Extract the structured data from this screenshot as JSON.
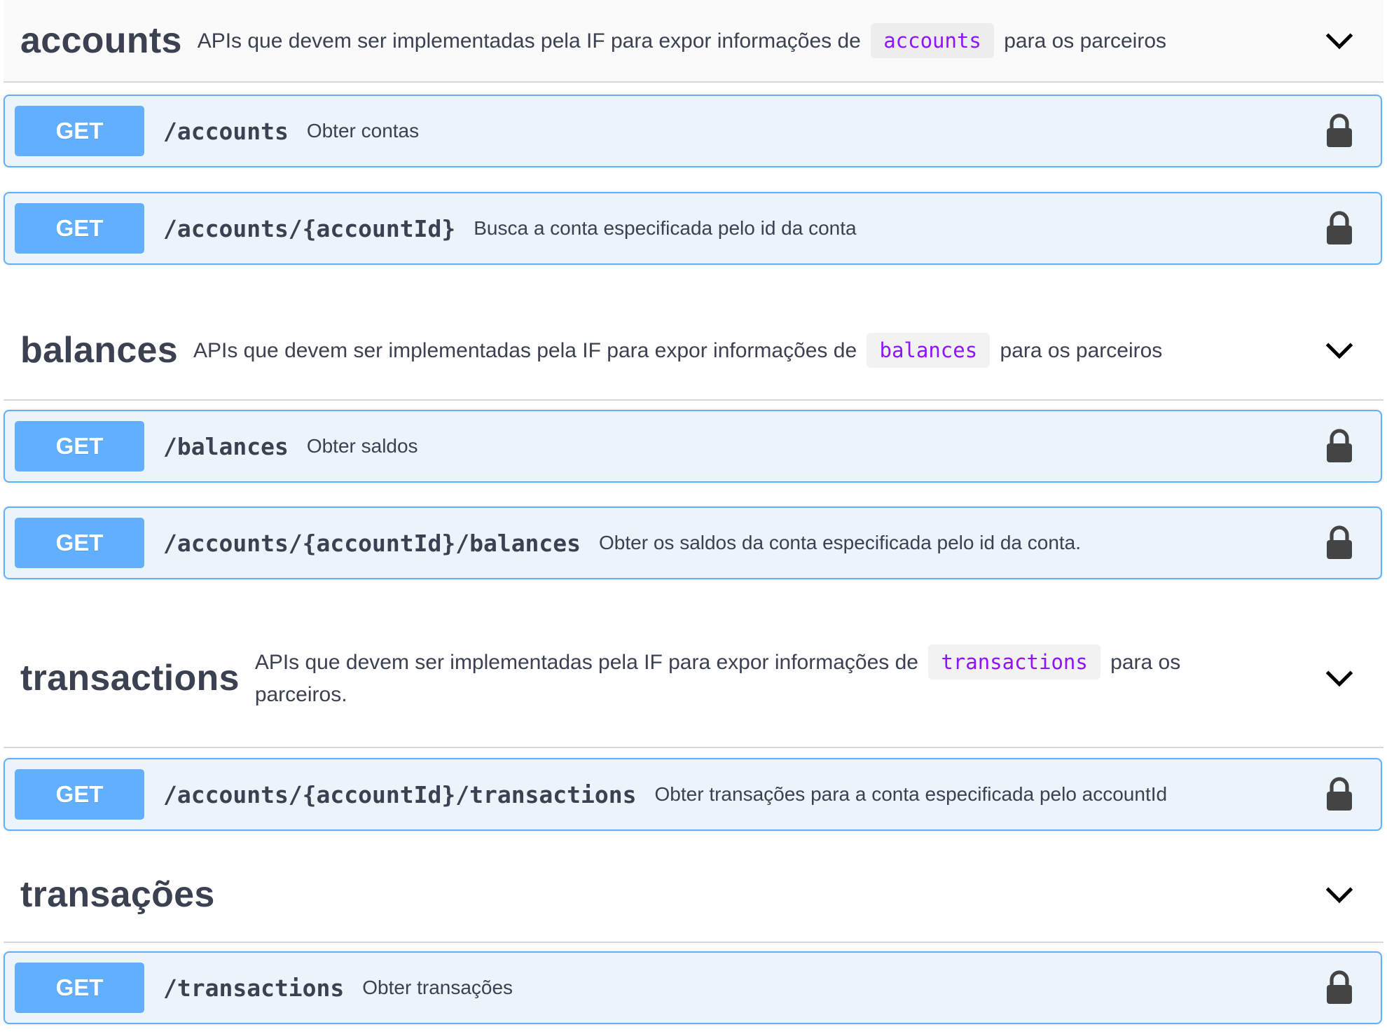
{
  "sections": [
    {
      "name": "accounts",
      "desc_before": "APIs que devem ser implementadas pela IF para expor informações de",
      "code": "accounts",
      "desc_after": "para os parceiros",
      "operations": [
        {
          "method": "GET",
          "path": "/accounts",
          "summary": "Obter contas"
        },
        {
          "method": "GET",
          "path": "/accounts/{accountId}",
          "summary": "Busca a conta especificada pelo id da conta"
        }
      ]
    },
    {
      "name": "balances",
      "desc_before": "APIs que devem ser implementadas pela IF para expor informações de",
      "code": "balances",
      "desc_after": "para os parceiros",
      "operations": [
        {
          "method": "GET",
          "path": "/balances",
          "summary": "Obter saldos"
        },
        {
          "method": "GET",
          "path": "/accounts/{accountId}/balances",
          "summary": "Obter os saldos da conta especificada pelo id da conta."
        }
      ]
    },
    {
      "name": "transactions",
      "desc_before": "APIs que devem ser implementadas pela IF para expor informações de",
      "code": "transactions",
      "desc_after": "para os parceiros.",
      "operations": [
        {
          "method": "GET",
          "path": "/accounts/{accountId}/transactions",
          "summary": "Obter transações para a conta especificada pelo accountId"
        }
      ]
    },
    {
      "name": "transações",
      "operations": [
        {
          "method": "GET",
          "path": "/transactions",
          "summary": "Obter transações"
        }
      ]
    }
  ],
  "icons": {
    "expand": "chevron-down-icon",
    "auth": "lock-icon"
  },
  "colors": {
    "get_method": "#61affe",
    "get_background": "#ebf3fb",
    "code_text": "#9012fe",
    "text": "#3b4151"
  }
}
